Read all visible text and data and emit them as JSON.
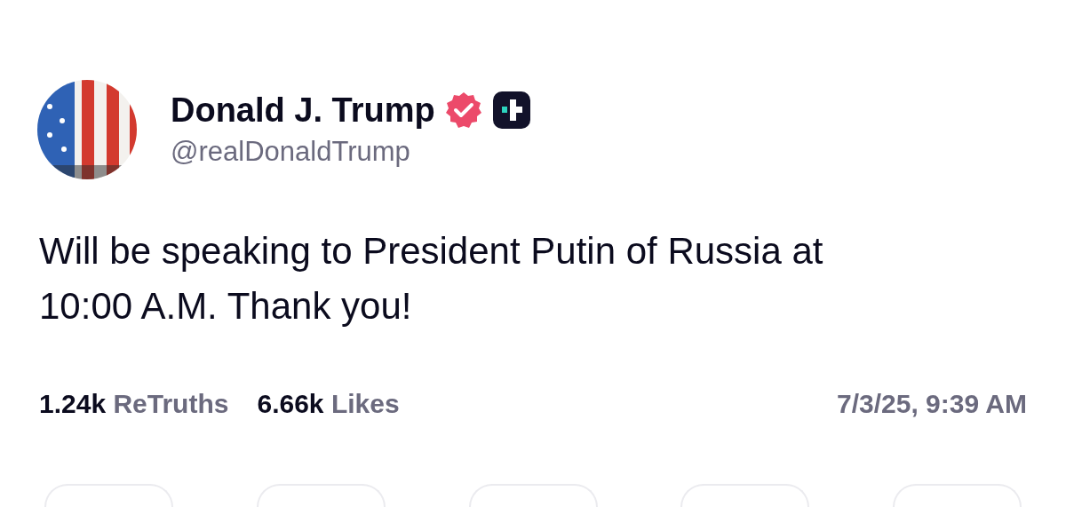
{
  "post": {
    "author": {
      "name": "Donald J. Trump",
      "handle": "@realDonaldTrump",
      "verified": true
    },
    "text": "Will be speaking to President Putin of Russia at 10:00 A.M. Thank you!",
    "stats": [
      {
        "count": "1.24k",
        "label": "ReTruths"
      },
      {
        "count": "6.66k",
        "label": "Likes"
      }
    ],
    "timestamp": "7/3/25, 9:39 AM"
  }
}
